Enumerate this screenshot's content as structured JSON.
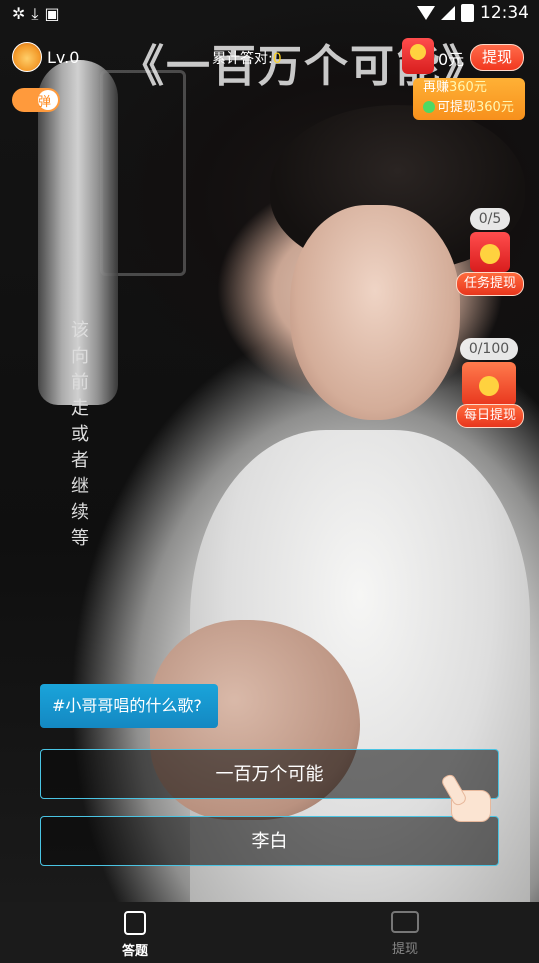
{
  "status_bar": {
    "time": "12:34",
    "left_icons": [
      "compass-icon",
      "download-icon",
      "font-icon"
    ],
    "right_icons": [
      "wifi-icon",
      "signal-icon",
      "battery-icon"
    ]
  },
  "video": {
    "song_title_overlay": "《一百万个可能》",
    "vertical_lyric": "该向前走或者继续等"
  },
  "header": {
    "level": "Lv.0",
    "counter_label": "累计答对:",
    "counter_value": "0",
    "balance": "0元",
    "withdraw_button": "提现"
  },
  "earn_box": {
    "line1_prefix": "再赚",
    "line1_value": "360元",
    "line2_prefix": "可提现",
    "line2_value": "360元"
  },
  "danmaku_toggle": {
    "label": "弹",
    "enabled": true
  },
  "task_withdraw": {
    "progress": "0/5",
    "label": "任务提现"
  },
  "daily_withdraw": {
    "progress": "0/100",
    "label": "每日提现"
  },
  "quiz": {
    "question": "#小哥哥唱的什么歌?",
    "options": [
      "一百万个可能",
      "李白"
    ]
  },
  "tabbar": {
    "tabs": [
      {
        "label": "答题",
        "icon": "quiz-icon",
        "active": true
      },
      {
        "label": "提现",
        "icon": "wallet-icon",
        "active": false
      }
    ]
  },
  "colors": {
    "accent_blue": "#1aa4da",
    "accent_orange": "#f7901c",
    "accent_red": "#e8361d",
    "highlight_yellow": "#ffd21f"
  }
}
